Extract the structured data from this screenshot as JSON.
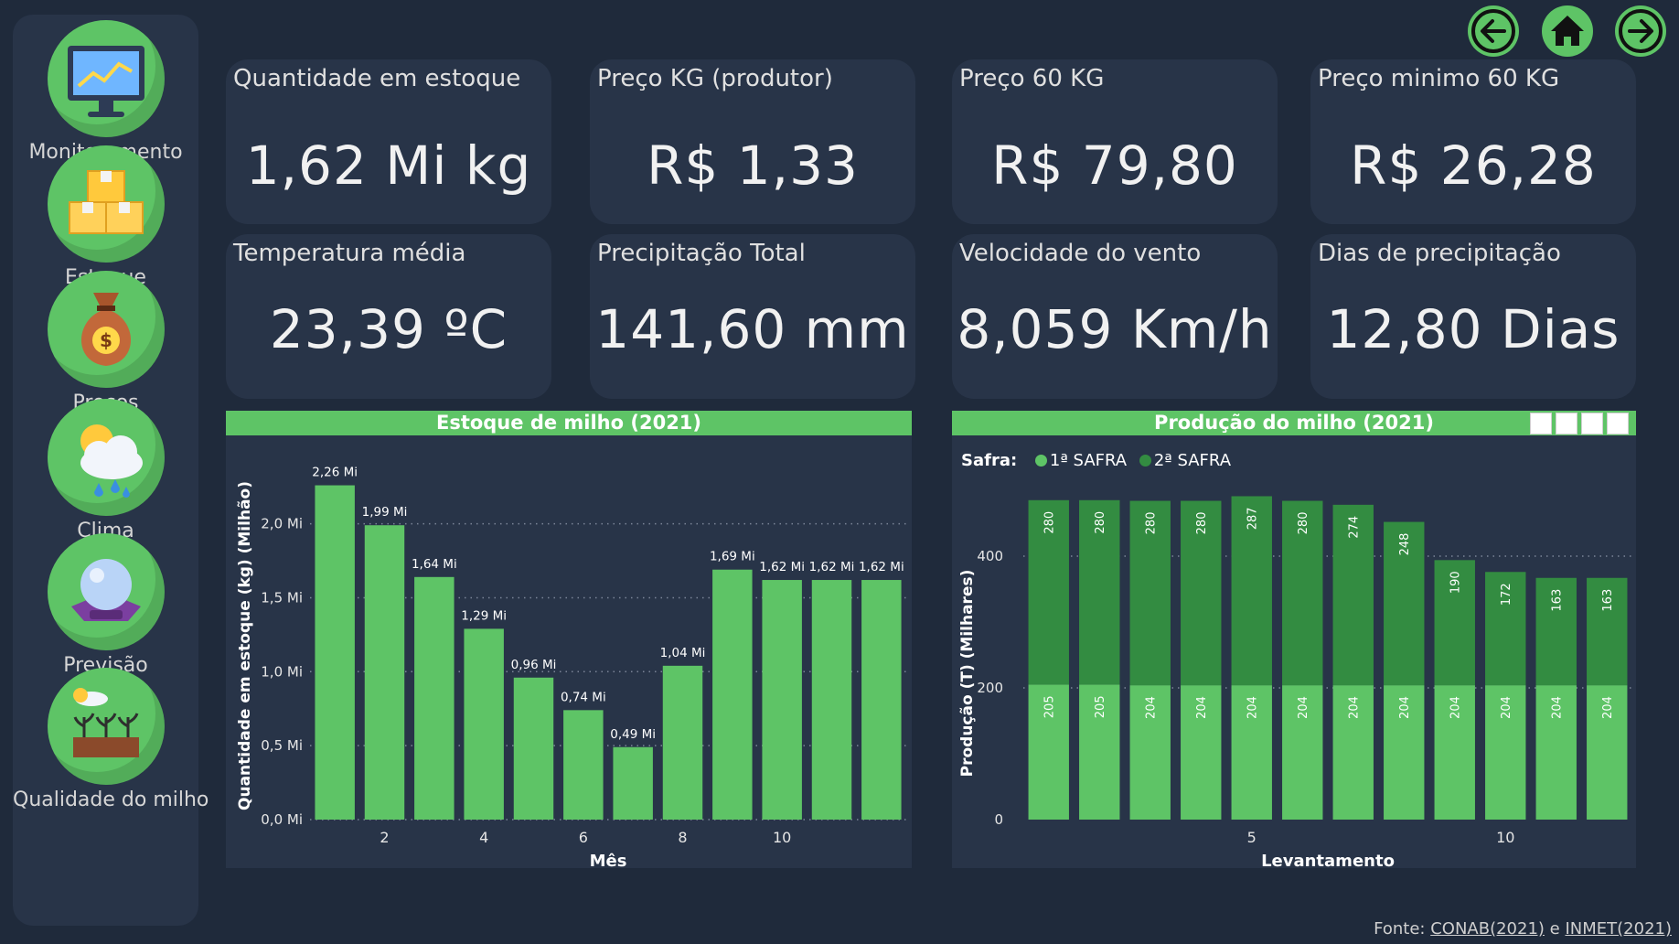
{
  "nav": [
    {
      "label": "Monitoramento",
      "icon": "monitor-icon"
    },
    {
      "label": "Estoque",
      "icon": "boxes-icon"
    },
    {
      "label": "Preços",
      "icon": "money-bag-icon"
    },
    {
      "label": "Clima",
      "icon": "weather-icon"
    },
    {
      "label": "Previsão",
      "icon": "crystal-ball-icon"
    },
    {
      "label": "Qualidade do milho",
      "icon": "crop-icon"
    }
  ],
  "top_buttons": {
    "back": "arrow-left-icon",
    "home": "home-icon",
    "forward": "arrow-right-icon"
  },
  "kpis": [
    {
      "title": "Quantidade em estoque",
      "value": "1,62 Mi  kg"
    },
    {
      "title": "Preço KG (produtor)",
      "value": "R$ 1,33"
    },
    {
      "title": "Preço 60 KG",
      "value": "R$ 79,80"
    },
    {
      "title": "Preço minimo 60 KG",
      "value": "R$ 26,28"
    },
    {
      "title": "Temperatura média",
      "value": "23,39  ºC"
    },
    {
      "title": "Precipitação Total",
      "value": "141,60  mm"
    },
    {
      "title": "Velocidade do vento",
      "value": "8,059  Km/h"
    },
    {
      "title": "Dias de precipitação",
      "value": "12,80  Dias"
    }
  ],
  "colors": {
    "background": "#1f2a3b",
    "panel": "#283448",
    "accent": "#5ec466",
    "dark_green": "#338c41"
  },
  "legend": {
    "title": "Safra:",
    "items": [
      "1ª SAFRA",
      "2ª SAFRA"
    ]
  },
  "footer": {
    "prefix": "Fonte: ",
    "link1": "CONAB(2021)",
    "sep": " e ",
    "link2": "INMET(2021)"
  },
  "chart_data": [
    {
      "type": "bar",
      "title": "Estoque de milho (2021)",
      "xlabel": "Mês",
      "ylabel": "Quantidade em estoque (kg) (Milhão)",
      "x": [
        1,
        2,
        3,
        4,
        5,
        6,
        7,
        8,
        9,
        10,
        11,
        12
      ],
      "values": [
        2.26,
        1.99,
        1.64,
        1.29,
        0.96,
        0.74,
        0.49,
        1.04,
        1.69,
        1.62,
        1.62,
        1.62
      ],
      "data_labels": [
        "2,26 Mi",
        "1,99 Mi",
        "1,64 Mi",
        "1,29 Mi",
        "0,96 Mi",
        "0,74 Mi",
        "0,49 Mi",
        "1,04 Mi",
        "1,69 Mi",
        "1,62 Mi",
        "1,62 Mi",
        "1,62 Mi"
      ],
      "x_ticks": [
        "2",
        "4",
        "6",
        "8",
        "10"
      ],
      "y_ticks": [
        "0,0 Mi",
        "0,5 Mi",
        "1,0 Mi",
        "1,5 Mi",
        "2,0 Mi"
      ],
      "ylim": [
        0,
        2.35
      ],
      "grid": true
    },
    {
      "type": "bar",
      "stacked": true,
      "title": "Produção do milho (2021)",
      "xlabel": "Levantamento",
      "ylabel": "Produção (T) (Milhares)",
      "x": [
        1,
        2,
        3,
        4,
        5,
        6,
        7,
        8,
        9,
        10,
        11,
        12
      ],
      "series": [
        {
          "name": "1ª SAFRA",
          "values": [
            205,
            205,
            204,
            204,
            204,
            204,
            204,
            204,
            204,
            204,
            204,
            204
          ]
        },
        {
          "name": "2ª SAFRA",
          "values": [
            280,
            280,
            280,
            280,
            287,
            280,
            274,
            248,
            190,
            172,
            163,
            163
          ]
        }
      ],
      "x_ticks": [
        "5",
        "10"
      ],
      "y_ticks": [
        "0",
        "200",
        "400"
      ],
      "ylim": [
        0,
        500
      ],
      "legend": "top-left",
      "grid": true
    }
  ]
}
